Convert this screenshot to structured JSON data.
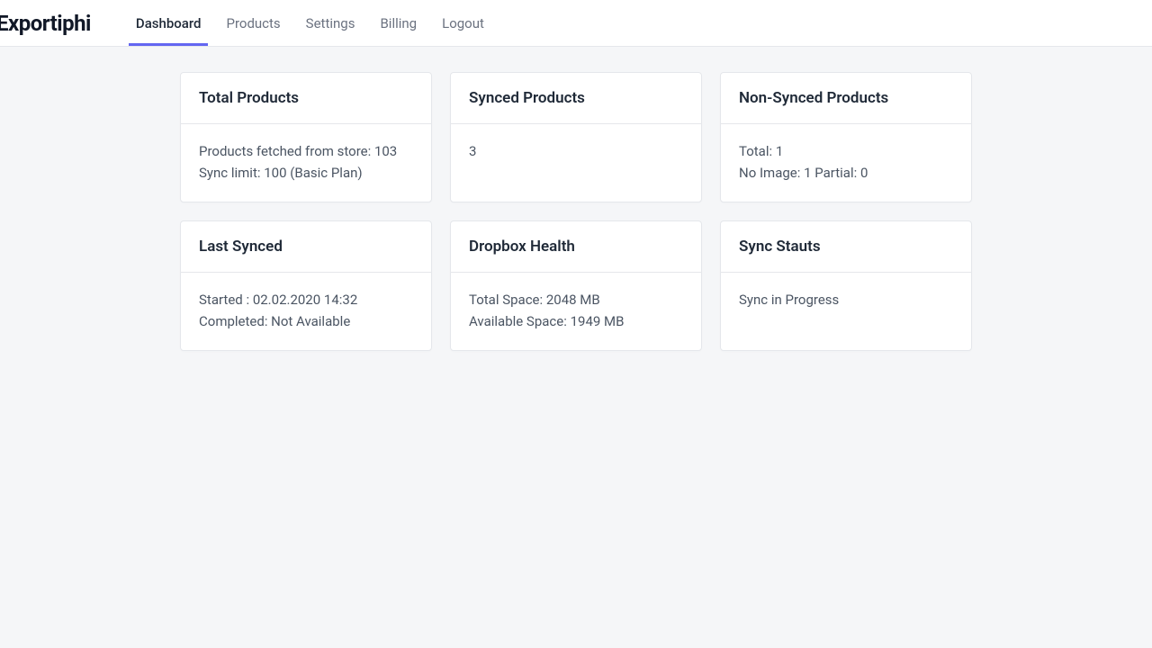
{
  "logo": "Exportiphi",
  "nav": {
    "dashboard": "Dashboard",
    "products": "Products",
    "settings": "Settings",
    "billing": "Billing",
    "logout": "Logout"
  },
  "cards": {
    "totalProducts": {
      "title": "Total Products",
      "line1": "Products fetched from store: 103",
      "line2": "Sync limit: 100 (Basic Plan)"
    },
    "syncedProducts": {
      "title": "Synced Products",
      "line1": "3"
    },
    "nonSyncedProducts": {
      "title": "Non-Synced Products",
      "line1": "Total: 1",
      "line2": "No Image: 1 Partial: 0"
    },
    "lastSynced": {
      "title": "Last Synced",
      "line1": "Started : 02.02.2020 14:32",
      "line2": "Completed: Not Available"
    },
    "dropboxHealth": {
      "title": "Dropbox Health",
      "line1": "Total Space: 2048 MB",
      "line2": "Available Space: 1949 MB"
    },
    "syncStatus": {
      "title": "Sync Stauts",
      "line1": "Sync in Progress"
    }
  }
}
